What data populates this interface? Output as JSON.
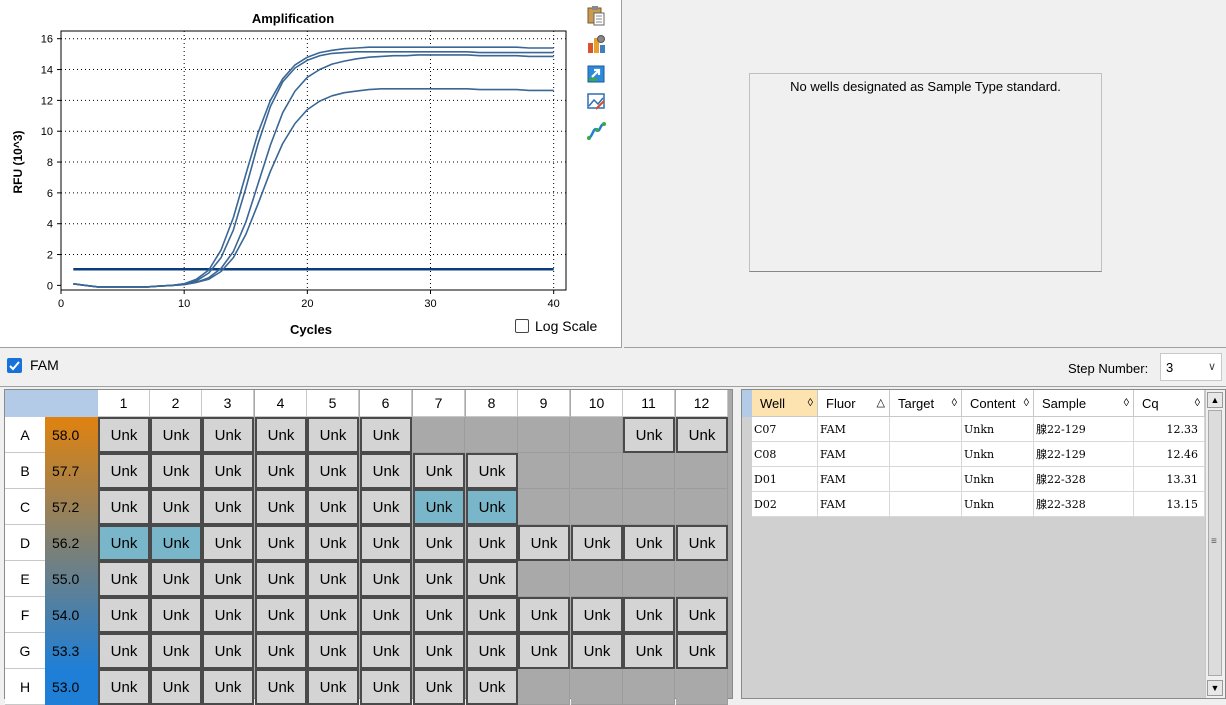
{
  "amplification": {
    "title": "Amplification",
    "ylabel": "RFU (10^3)",
    "xlabel": "Cycles",
    "log_scale_label": "Log Scale",
    "log_scale_checked": false
  },
  "chart_data": {
    "type": "line",
    "title": "Amplification",
    "xlabel": "Cycles",
    "ylabel": "RFU (10^3)",
    "xlim": [
      0,
      41
    ],
    "ylim": [
      -0.3,
      16.5
    ],
    "x_ticks": [
      "0",
      "10",
      "20",
      "30",
      "40"
    ],
    "y_ticks": [
      "0",
      "2",
      "4",
      "6",
      "8",
      "10",
      "12",
      "14",
      "16"
    ],
    "grid": "dotted",
    "threshold": 1.05,
    "x": [
      1,
      2,
      3,
      4,
      5,
      6,
      7,
      8,
      9,
      10,
      11,
      12,
      13,
      14,
      15,
      16,
      17,
      18,
      19,
      20,
      21,
      22,
      23,
      24,
      25,
      26,
      27,
      28,
      29,
      30,
      31,
      32,
      33,
      34,
      35,
      36,
      37,
      38,
      39,
      40
    ],
    "series": [
      {
        "values": [
          0.1,
          0.0,
          -0.1,
          -0.1,
          -0.1,
          -0.1,
          -0.1,
          -0.05,
          0.0,
          0.1,
          0.4,
          1.0,
          2.3,
          4.4,
          7.2,
          9.9,
          12.0,
          13.4,
          14.3,
          14.8,
          15.1,
          15.25,
          15.35,
          15.4,
          15.45,
          15.45,
          15.45,
          15.45,
          15.45,
          15.45,
          15.45,
          15.45,
          15.45,
          15.45,
          15.45,
          15.45,
          15.45,
          15.4,
          15.4,
          15.4
        ]
      },
      {
        "values": [
          0.1,
          0.0,
          -0.1,
          -0.1,
          -0.1,
          -0.1,
          -0.1,
          -0.05,
          0.0,
          0.1,
          0.3,
          0.8,
          1.8,
          3.6,
          6.3,
          9.2,
          11.6,
          13.2,
          14.1,
          14.6,
          14.9,
          15.05,
          15.1,
          15.15,
          15.15,
          15.15,
          15.15,
          15.15,
          15.15,
          15.15,
          15.15,
          15.15,
          15.15,
          15.1,
          15.1,
          15.1,
          15.1,
          15.1,
          15.1,
          15.1
        ]
      },
      {
        "values": [
          0.1,
          0.0,
          -0.1,
          -0.1,
          -0.1,
          -0.1,
          -0.1,
          -0.05,
          0.0,
          0.05,
          0.2,
          0.5,
          1.1,
          2.2,
          4.1,
          6.6,
          9.1,
          11.2,
          12.6,
          13.5,
          14.0,
          14.35,
          14.55,
          14.7,
          14.8,
          14.85,
          14.9,
          14.9,
          14.95,
          14.95,
          14.95,
          14.95,
          14.95,
          14.9,
          14.9,
          14.9,
          14.9,
          14.85,
          14.85,
          14.85
        ]
      },
      {
        "values": [
          0.1,
          0.0,
          -0.1,
          -0.1,
          -0.1,
          -0.1,
          -0.1,
          -0.05,
          0.0,
          0.05,
          0.2,
          0.4,
          0.9,
          1.8,
          3.3,
          5.3,
          7.4,
          9.2,
          10.5,
          11.4,
          11.95,
          12.3,
          12.5,
          12.6,
          12.7,
          12.75,
          12.75,
          12.75,
          12.75,
          12.75,
          12.75,
          12.75,
          12.75,
          12.7,
          12.7,
          12.7,
          12.7,
          12.65,
          12.65,
          12.65
        ]
      }
    ]
  },
  "colors": {
    "curve": "#3a6796",
    "threshold": "#0b3d7a",
    "temp_gradient": [
      "#e0820f",
      "#1f7fd6"
    ]
  },
  "toolbar_icons": [
    "clipboard-icon",
    "chart-settings-icon",
    "export-icon",
    "image-settings-icon",
    "curve-icon"
  ],
  "standard_curve": {
    "message": "No wells designated as Sample Type standard."
  },
  "fluor_bar": {
    "fluor": "FAM",
    "fluor_checked": true,
    "step_label": "Step Number:",
    "step_value": "3"
  },
  "plate": {
    "columns": [
      "1",
      "2",
      "3",
      "4",
      "5",
      "6",
      "7",
      "8",
      "9",
      "10",
      "11",
      "12"
    ],
    "rows": [
      {
        "label": "A",
        "temp": "58.0",
        "wells": [
          "Unk",
          "Unk",
          "Unk",
          "Unk",
          "Unk",
          "Unk",
          "",
          "",
          "",
          "",
          "Unk",
          "Unk"
        ],
        "selected": []
      },
      {
        "label": "B",
        "temp": "57.7",
        "wells": [
          "Unk",
          "Unk",
          "Unk",
          "Unk",
          "Unk",
          "Unk",
          "Unk",
          "Unk",
          "",
          "",
          "",
          ""
        ],
        "selected": []
      },
      {
        "label": "C",
        "temp": "57.2",
        "wells": [
          "Unk",
          "Unk",
          "Unk",
          "Unk",
          "Unk",
          "Unk",
          "Unk",
          "Unk",
          "",
          "",
          "",
          ""
        ],
        "selected": [
          6,
          7
        ]
      },
      {
        "label": "D",
        "temp": "56.2",
        "wells": [
          "Unk",
          "Unk",
          "Unk",
          "Unk",
          "Unk",
          "Unk",
          "Unk",
          "Unk",
          "Unk",
          "Unk",
          "Unk",
          "Unk"
        ],
        "selected": [
          0,
          1
        ]
      },
      {
        "label": "E",
        "temp": "55.0",
        "wells": [
          "Unk",
          "Unk",
          "Unk",
          "Unk",
          "Unk",
          "Unk",
          "Unk",
          "Unk",
          "",
          "",
          "",
          ""
        ],
        "selected": []
      },
      {
        "label": "F",
        "temp": "54.0",
        "wells": [
          "Unk",
          "Unk",
          "Unk",
          "Unk",
          "Unk",
          "Unk",
          "Unk",
          "Unk",
          "Unk",
          "Unk",
          "Unk",
          "Unk"
        ],
        "selected": []
      },
      {
        "label": "G",
        "temp": "53.3",
        "wells": [
          "Unk",
          "Unk",
          "Unk",
          "Unk",
          "Unk",
          "Unk",
          "Unk",
          "Unk",
          "Unk",
          "Unk",
          "Unk",
          "Unk"
        ],
        "selected": []
      },
      {
        "label": "H",
        "temp": "53.0",
        "wells": [
          "Unk",
          "Unk",
          "Unk",
          "Unk",
          "Unk",
          "Unk",
          "Unk",
          "Unk",
          "",
          "",
          "",
          ""
        ],
        "selected": []
      }
    ]
  },
  "results_table": {
    "columns": [
      {
        "label": "Well",
        "sort": "◊",
        "sorted": true
      },
      {
        "label": "Fluor",
        "sort": "△",
        "sorted": false
      },
      {
        "label": "Target",
        "sort": "◊",
        "sorted": false
      },
      {
        "label": "Content",
        "sort": "◊",
        "sorted": false
      },
      {
        "label": "Sample",
        "sort": "◊",
        "sorted": false
      },
      {
        "label": "Cq",
        "sort": "◊",
        "sorted": false
      }
    ],
    "rows": [
      [
        "C07",
        "FAM",
        "",
        "Unkn",
        "腺22-129",
        "12.33"
      ],
      [
        "C08",
        "FAM",
        "",
        "Unkn",
        "腺22-129",
        "12.46"
      ],
      [
        "D01",
        "FAM",
        "",
        "Unkn",
        "腺22-328",
        "13.31"
      ],
      [
        "D02",
        "FAM",
        "",
        "Unkn",
        "腺22-328",
        "13.15"
      ]
    ]
  }
}
